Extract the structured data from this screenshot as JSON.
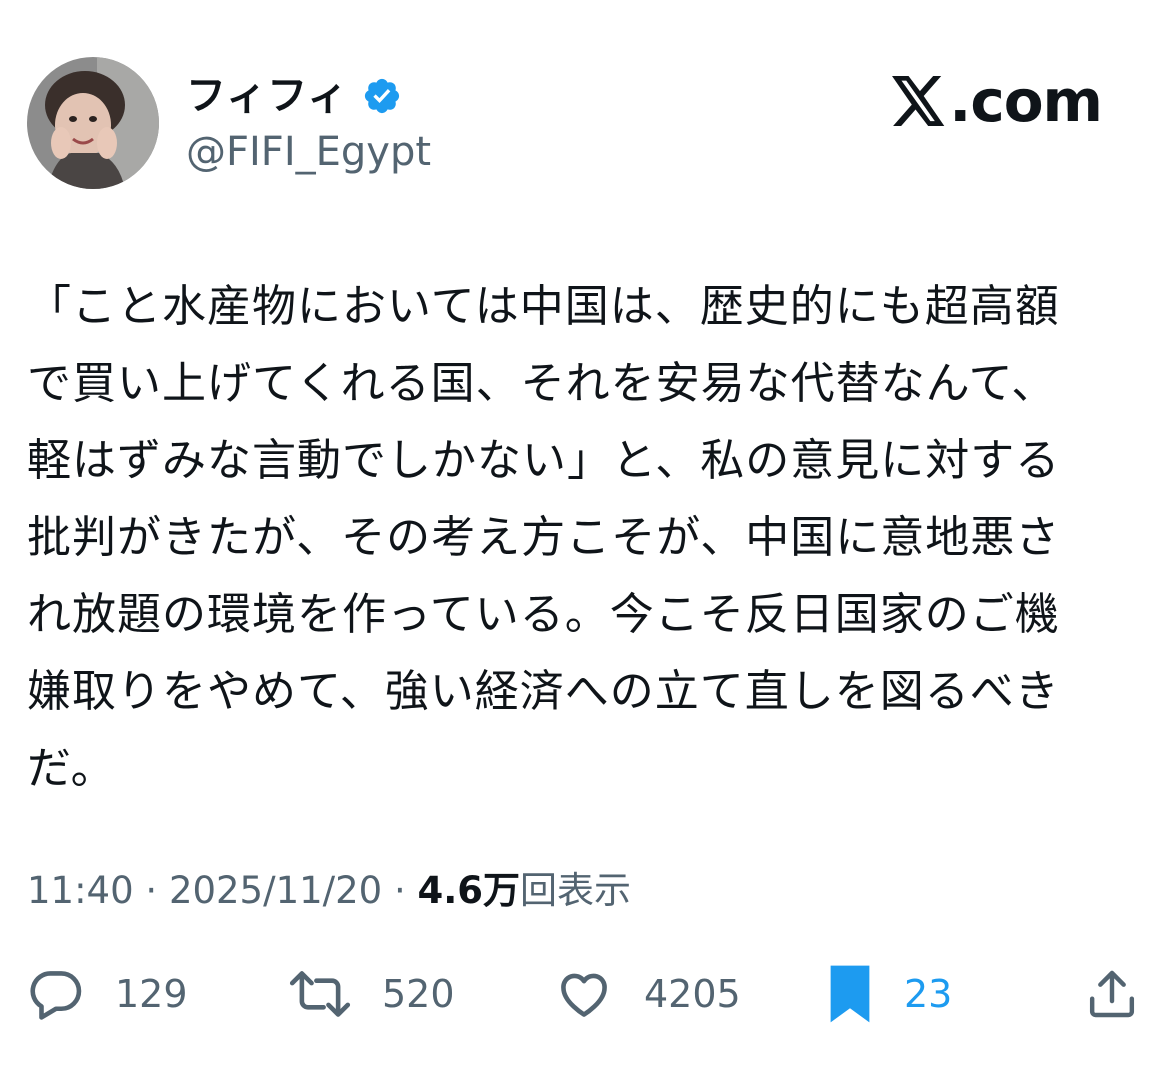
{
  "author": {
    "display_name": "フィフィ",
    "handle": "@FIFI_Egypt",
    "verified": true
  },
  "brand": {
    "label": ".com"
  },
  "tweet": {
    "lines": [
      "「こと水産物においては中国は、歴史的にも超高額",
      "で買い上げてくれる国、それを安易な代替なんて、",
      "軽はずみな言動でしかない」と、私の意見に対する",
      "批判がきたが、その考え方こそが、中国に意地悪さ",
      "れ放題の環境を作っている。今こそ反日国家のご機",
      "嫌取りをやめて、強い経済への立て直しを図るべき",
      "だ。"
    ]
  },
  "meta": {
    "time": "11:40",
    "date": "2025/11/20",
    "separator": "·",
    "views_count": "4.6万",
    "views_label": "回表示"
  },
  "actions": {
    "replies": "129",
    "reposts": "520",
    "likes": "4205",
    "bookmarks": "23"
  },
  "colors": {
    "text": "#0f1419",
    "secondary": "#536471",
    "accent": "#1d9bf0"
  }
}
